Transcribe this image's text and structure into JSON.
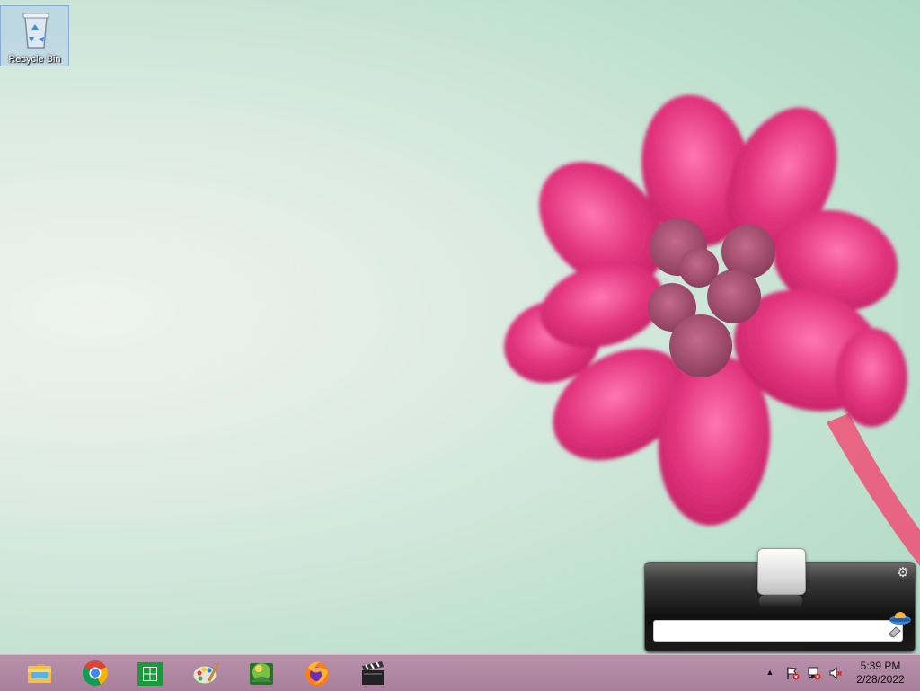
{
  "desktop": {
    "icons": [
      {
        "label": "Recycle Bin",
        "icon": "recycle-bin-icon"
      }
    ]
  },
  "gadget": {
    "search_value": "",
    "icons": [
      "settings-gear-icon",
      "ufo-icon",
      "eraser-icon"
    ]
  },
  "taskbar": {
    "pinned": [
      {
        "name": "File Explorer",
        "icon": "folder-icon"
      },
      {
        "name": "Google Chrome",
        "icon": "chrome-icon"
      },
      {
        "name": "Store",
        "icon": "store-icon"
      },
      {
        "name": "Paint",
        "icon": "paint-palette-icon"
      },
      {
        "name": "Photo App",
        "icon": "photo-gallery-icon"
      },
      {
        "name": "Firefox",
        "icon": "firefox-icon"
      },
      {
        "name": "Movie Maker",
        "icon": "clapperboard-icon"
      }
    ],
    "tray": {
      "icons": [
        "show-hidden-icons-arrow",
        "action-center-flag-icon",
        "network-icon",
        "volume-muted-icon"
      ]
    },
    "clock": {
      "time": "5:39 PM",
      "date": "2/28/2022"
    }
  },
  "colors": {
    "taskbar": "#b08aa3",
    "flower": "#e23b86"
  }
}
